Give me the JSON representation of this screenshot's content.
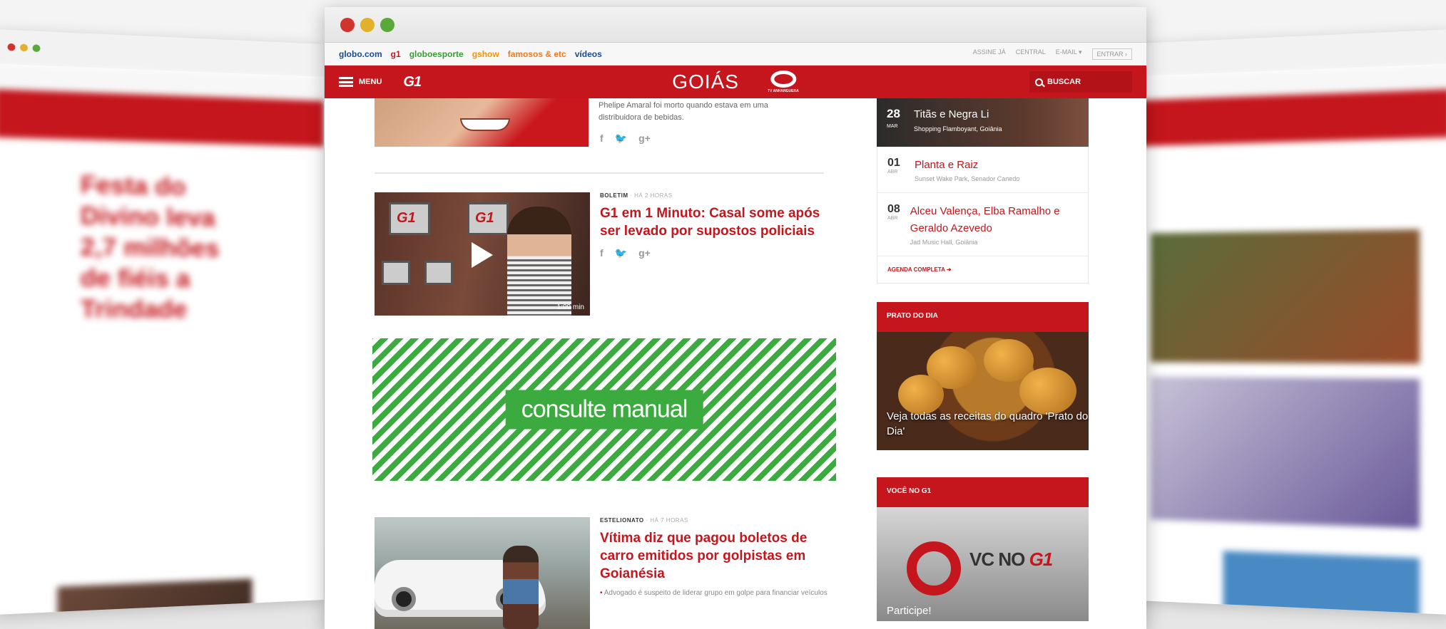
{
  "browser": {
    "traffic_lights": [
      "#d0342c",
      "#e1b12c",
      "#5aa83a"
    ]
  },
  "globo_bar": {
    "links": [
      {
        "label": "globo.com",
        "color": "#1a4c8f"
      },
      {
        "label": "g1",
        "color": "#c4161c"
      },
      {
        "label": "globoesporte",
        "color": "#3a9a36"
      },
      {
        "label": "gshow",
        "color": "#f29400"
      },
      {
        "label": "famosos & etc",
        "color": "#ee7a1e"
      },
      {
        "label": "vídeos",
        "color": "#1a4c8f"
      }
    ],
    "right": {
      "assine": "ASSINE JÁ",
      "central": "CENTRAL",
      "email": "E-MAIL ▾",
      "entrar": "ENTRAR ›"
    }
  },
  "header": {
    "menu_label": "MENU",
    "logo": "G1",
    "region": "GOIÁS",
    "affiliate": "TV ANHANGUERA",
    "search_label": "BUSCAR",
    "accent": "#c4161c"
  },
  "feed": {
    "story1": {
      "summary": "Phelipe Amaral foi morto quando estava em uma distribuidora de bebidas.",
      "share": [
        "f",
        "🐦",
        "g+"
      ]
    },
    "story2": {
      "kicker": "BOLETIM",
      "time": "HÁ 2 HORAS",
      "headline": "G1 em 1 Minuto: Casal some após ser levado por supostos policiais",
      "duration": "1:09 min",
      "share": [
        "f",
        "🐦",
        "g+"
      ]
    },
    "ad": {
      "label": "consulte manual",
      "color": "#3cab3f"
    },
    "story3": {
      "kicker": "ESTELIONATO",
      "time": "HÁ 7 HORAS",
      "headline": "Vítima diz que pagou boletos de carro emitidos por golpistas em Goianésia",
      "related": "Advogado é suspeito de liderar grupo em golpe para financiar veículos"
    }
  },
  "agenda": {
    "featured": {
      "day": "28",
      "month": "MAR",
      "title": "Titãs e Negra Li",
      "place": "Shopping Flamboyant, Goiânia"
    },
    "items": [
      {
        "day": "01",
        "month": "ABR",
        "title": "Planta e Raiz",
        "place": "Sunset Wake Park, Senador Canedo"
      },
      {
        "day": "08",
        "month": "ABR",
        "title": "Alceu Valença, Elba Ramalho e Geraldo Azevedo",
        "place": "Jad Music Hall, Goiânia"
      }
    ],
    "more_label": "AGENDA COMPLETA ➜"
  },
  "prato": {
    "head": "PRATO DO DIA",
    "caption": "Veja todas as receitas do quadro 'Prato do Dia'"
  },
  "vc": {
    "head": "VOCÊ NO G1",
    "logo_vc": "VC NO ",
    "logo_g1": "G1",
    "cta": "Participe!"
  },
  "side_left": {
    "headline": "Festa do Divino leva 2,7 milhões de fiéis a Trindade",
    "traffic_lights": [
      "#d0342c",
      "#e1b12c",
      "#5aa83a"
    ]
  }
}
